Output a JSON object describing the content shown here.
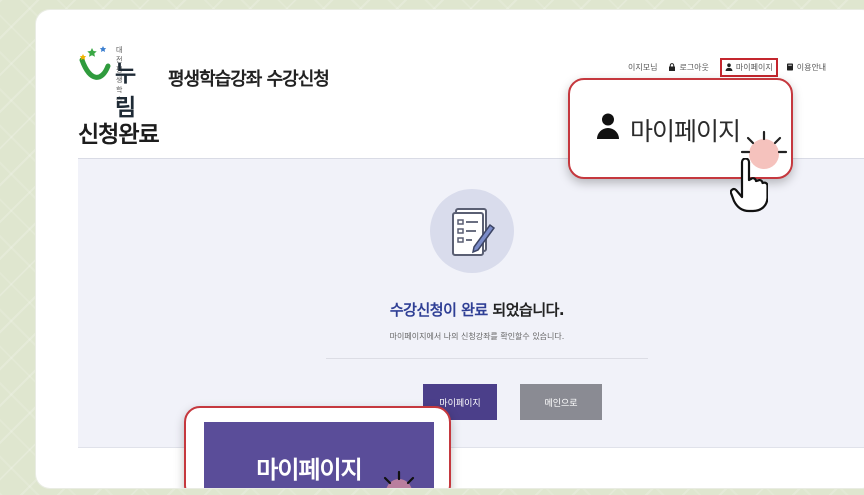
{
  "header": {
    "logo_sub": "대전평생학습",
    "logo_text": "누림",
    "app_title": "평생학습강좌 수강신청"
  },
  "top_links": [
    {
      "label": "이지모님",
      "icon": "none"
    },
    {
      "label": "로그아웃",
      "icon": "lock-icon"
    },
    {
      "label": "마이페이지",
      "icon": "person-icon"
    },
    {
      "label": "이용안내",
      "icon": "book-icon"
    }
  ],
  "page": {
    "title": "신청완료"
  },
  "result": {
    "message_highlight": "수강신청이 완료",
    "message_rest": " 되었습니다.",
    "sub_message": "마이페이지에서 나의 신청강좌를 확인할수 있습니다."
  },
  "buttons": {
    "mypage": "마이페이지",
    "home": "메인으로"
  },
  "callouts": {
    "top_label": "마이페이지",
    "bottom_label": "마이페이지"
  },
  "colors": {
    "accent": "#4b3f8a",
    "highlight_text": "#2f3f95",
    "callout_border": "#c5383e",
    "background": "#dfe6cf"
  }
}
